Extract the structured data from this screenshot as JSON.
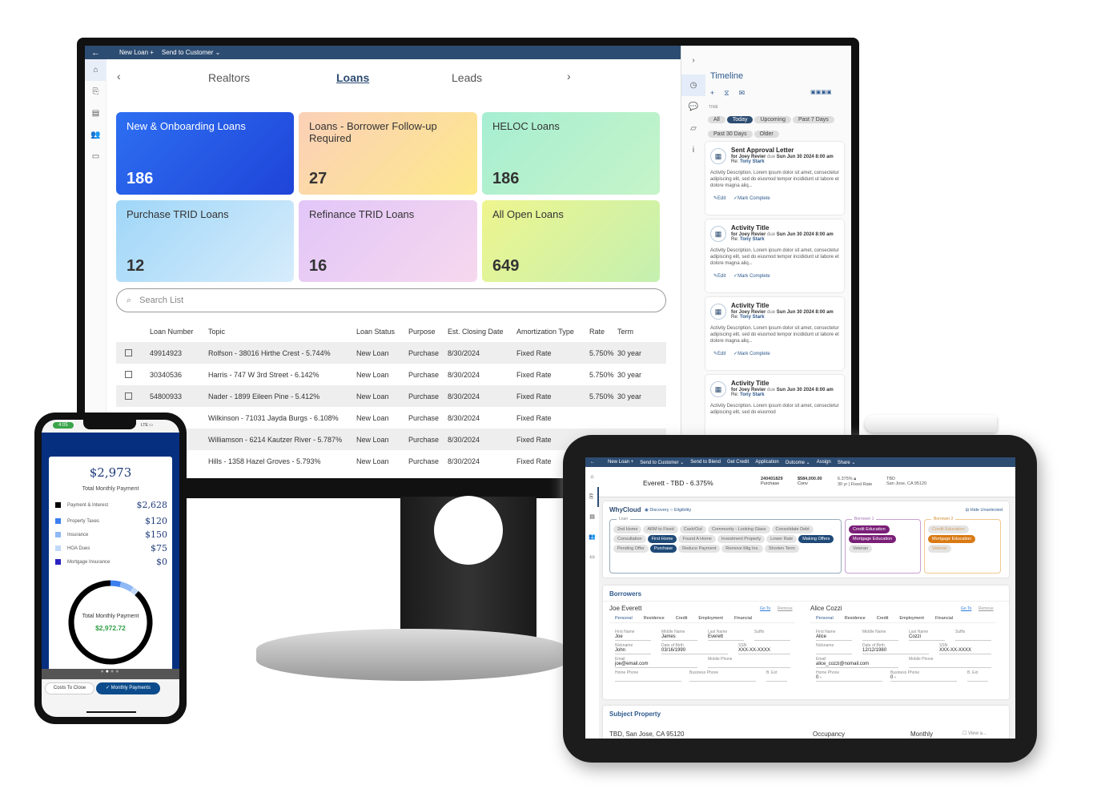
{
  "monitor": {
    "topbar": {
      "back_icon": "arrow-left-icon",
      "new_loan": "New Loan +",
      "send_to_customer": "Send to Customer ⌄"
    },
    "nav": {
      "tabs": [
        "Realtors",
        "Loans",
        "Leads"
      ],
      "active": "Loans"
    },
    "cards": [
      {
        "title": "New & Onboarding Loans",
        "count": "186"
      },
      {
        "title": "Loans - Borrower Follow-up Required",
        "count": "27"
      },
      {
        "title": "HELOC Loans",
        "count": "186"
      },
      {
        "title": "Purchase TRID Loans",
        "count": "12"
      },
      {
        "title": "Refinance TRID Loans",
        "count": "16"
      },
      {
        "title": "All Open Loans",
        "count": "649"
      }
    ],
    "search_placeholder": "Search List",
    "table": {
      "headers": [
        "Loan Number",
        "Topic",
        "Loan Status",
        "Purpose",
        "Est. Closing Date",
        "Amortization Type",
        "Rate",
        "Term"
      ],
      "rows": [
        [
          "49914923",
          "Rolfson - 38016 Hirthe Crest - 5.744%",
          "New Loan",
          "Purchase",
          "8/30/2024",
          "Fixed Rate",
          "5.750%",
          "30 year"
        ],
        [
          "30340536",
          "Harris - 747 W 3rd Street - 6.142%",
          "New Loan",
          "Purchase",
          "8/30/2024",
          "Fixed Rate",
          "5.750%",
          "30 year"
        ],
        [
          "54800933",
          "Nader - 1899 Eileen Pine - 5.412%",
          "New Loan",
          "Purchase",
          "8/30/2024",
          "Fixed Rate",
          "5.750%",
          "30 year"
        ],
        [
          "",
          "Wilkinson - 71031 Jayda Burgs - 6.108%",
          "New Loan",
          "Purchase",
          "8/30/2024",
          "Fixed Rate",
          "",
          ""
        ],
        [
          "",
          "Williamson - 6214 Kautzer River - 5.787%",
          "New Loan",
          "Purchase",
          "8/30/2024",
          "Fixed Rate",
          "",
          ""
        ],
        [
          "",
          "Hills - 1358 Hazel Groves - 5.793%",
          "New Loan",
          "Purchase",
          "8/30/2024",
          "Fixed Rate",
          "",
          ""
        ]
      ]
    },
    "timeline": {
      "title": "Timeline",
      "time_label": "TIME",
      "filters": [
        "All",
        "Today",
        "Upcoming",
        "Past 7 Days",
        "Past 30 Days",
        "Older"
      ],
      "active_filter": "Today",
      "items": [
        {
          "title": "Sent Approval Letter",
          "for": "for Joey Revier",
          "due": "due",
          "date": "Sun Jun 30 2024 8:00 am",
          "re": "Re:",
          "re_name": "Tony Stark",
          "desc": "Activity Description. Lorem ipsum dolor sit amet, consectetur adipiscing elit, sed do eiusmod tempor incididunt ut labore et dolore magna aliq...",
          "edit": "Edit",
          "complete": "Mark Complete"
        },
        {
          "title": "Activity Title",
          "for": "for Joey Revier",
          "due": "due",
          "date": "Sun Jun 30 2024 8:00 am",
          "re": "Re:",
          "re_name": "Tony Stark",
          "desc": "Activity Description. Lorem ipsum dolor sit amet, consectetur adipiscing elit, sed do eiusmod tempor incididunt ut labore et dolore magna aliq...",
          "edit": "Edit",
          "complete": "Mark Complete"
        },
        {
          "title": "Activity Title",
          "for": "for Joey Revier",
          "due": "due",
          "date": "Sun Jun 30 2024 8:00 am",
          "re": "Re:",
          "re_name": "Tony Stark",
          "desc": "Activity Description. Lorem ipsum dolor sit amet, consectetur adipiscing elit, sed do eiusmod tempor incididunt ut labore et dolore magna aliq...",
          "edit": "Edit",
          "complete": "Mark Complete"
        },
        {
          "title": "Activity Title",
          "for": "for Joey Revier",
          "due": "due",
          "date": "Sun Jun 30 2024 8:00 am",
          "re": "Re:",
          "re_name": "Tony Stark",
          "desc": "Activity Description. Lorem ipsum dolor sit amet, consectetur adipiscing elit, sed do eiusmod",
          "edit": "",
          "complete": ""
        }
      ]
    }
  },
  "phone": {
    "time": "4:05",
    "network": "LTE",
    "total": "$2,973",
    "total_label": "Total Monthly Payment",
    "items": [
      {
        "label": "Payment & Interest",
        "value": "$2,628",
        "color": "#000000"
      },
      {
        "label": "Property Taxes",
        "value": "$120",
        "color": "#3b7ff0"
      },
      {
        "label": "Insurance",
        "value": "$150",
        "color": "#8fb8f5"
      },
      {
        "label": "HOA Dues",
        "value": "$75",
        "color": "#c2d8f8"
      },
      {
        "label": "Mortgage Insurance",
        "value": "$0",
        "color": "#2a22c0"
      }
    ],
    "donut_label": "Total Monthly Payment",
    "donut_value": "$2,972.72",
    "buttons": {
      "costs": "Costs To Close",
      "monthly": "✓ Monthly Payments"
    }
  },
  "tablet": {
    "topbar": [
      "New Loan +",
      "Send to Customer ⌄",
      "Send to Blend",
      "Get Credit",
      "Application",
      "Outcome ⌄",
      "Assign",
      "Share ⌄"
    ],
    "header": {
      "title": "Everett - TBD - 6.375%",
      "loan_no": "240401829",
      "loan_type": "Purchase",
      "amount": "$584,000.00",
      "amount_type": "Conv",
      "rate": "6.375%",
      "term": "30 yr | Fixed Rate",
      "addr1": "TBD",
      "addr2": "San Jose, CA 95120"
    },
    "whycloud": {
      "title": "WhyCloud",
      "modes": [
        "Discovery",
        "Eligibility"
      ],
      "hide": "Hide Unselected",
      "loan_label": "Loan",
      "b1_label": "Borrower 1",
      "b2_label": "Borrower 2",
      "loan_tags": [
        [
          "2nd Home",
          0
        ],
        [
          "ARM to Fixed",
          0
        ],
        [
          "Cash/Out",
          0
        ],
        [
          "Community - Looking Glass",
          0
        ],
        [
          "Consolidate Debt",
          0
        ],
        [
          "Consultation",
          0
        ],
        [
          "First Home",
          1
        ],
        [
          "Found A Home",
          0
        ],
        [
          "Investment Property",
          0
        ],
        [
          "Lower Rate",
          0
        ],
        [
          "Making Offers",
          1
        ],
        [
          "Pending Offer",
          0
        ],
        [
          "Purchase",
          1
        ],
        [
          "Reduce Payment",
          0
        ],
        [
          "Remove Mtg Ins.",
          0
        ],
        [
          "Shorten Term",
          0
        ]
      ],
      "b1_tags": [
        [
          "Credit Education",
          1
        ],
        [
          "Mortgage Education",
          1
        ],
        [
          "Veteran",
          0
        ]
      ],
      "b2_tags": [
        [
          "Credit Education",
          0
        ],
        [
          "Mortgage Education",
          1
        ],
        [
          "Veteran",
          0
        ]
      ]
    },
    "borrowers": {
      "title": "Borrowers",
      "tabs": [
        "Personal",
        "Residence",
        "Credit",
        "Employment",
        "Financial"
      ],
      "goto": "Go To",
      "remove": "Remove",
      "people": [
        {
          "name": "Joe Everett",
          "first": "Joe",
          "middle": "James",
          "last": "Everett",
          "suffix": "",
          "nick": "John",
          "dob": "03/16/1990",
          "ssn": "XXX-XX-XXXX",
          "email": "joe@email.com",
          "home": "",
          "business": ""
        },
        {
          "name": "Alice Cozzi",
          "first": "Alice",
          "middle": "",
          "last": "Cozzi",
          "suffix": "",
          "nick": "",
          "dob": "12/12/1980",
          "ssn": "XXX-XX-XXXX",
          "email": "alice_cozzi@nomail.com",
          "home": "0 -",
          "business": "0 -"
        }
      ],
      "labels": {
        "first": "First Name",
        "middle": "Middle Name",
        "last": "Last Name",
        "suffix": "Suffix",
        "nick": "Nickname",
        "dob": "Date of Birth",
        "ssn": "SSN",
        "email": "Email",
        "mobile": "Mobile Phone",
        "home": "Home Phone",
        "business": "Business Phone",
        "ext": "B. Ext"
      }
    },
    "subject": {
      "title": "Subject Property",
      "address": "TBD, San Jose, CA 95120",
      "occupancy": "Occupancy",
      "monthly": "Monthly",
      "view": "View a..."
    }
  },
  "colors": {
    "brand": "#2d4c72",
    "phone_blue": "#062f80",
    "green": "#2f9e44"
  }
}
